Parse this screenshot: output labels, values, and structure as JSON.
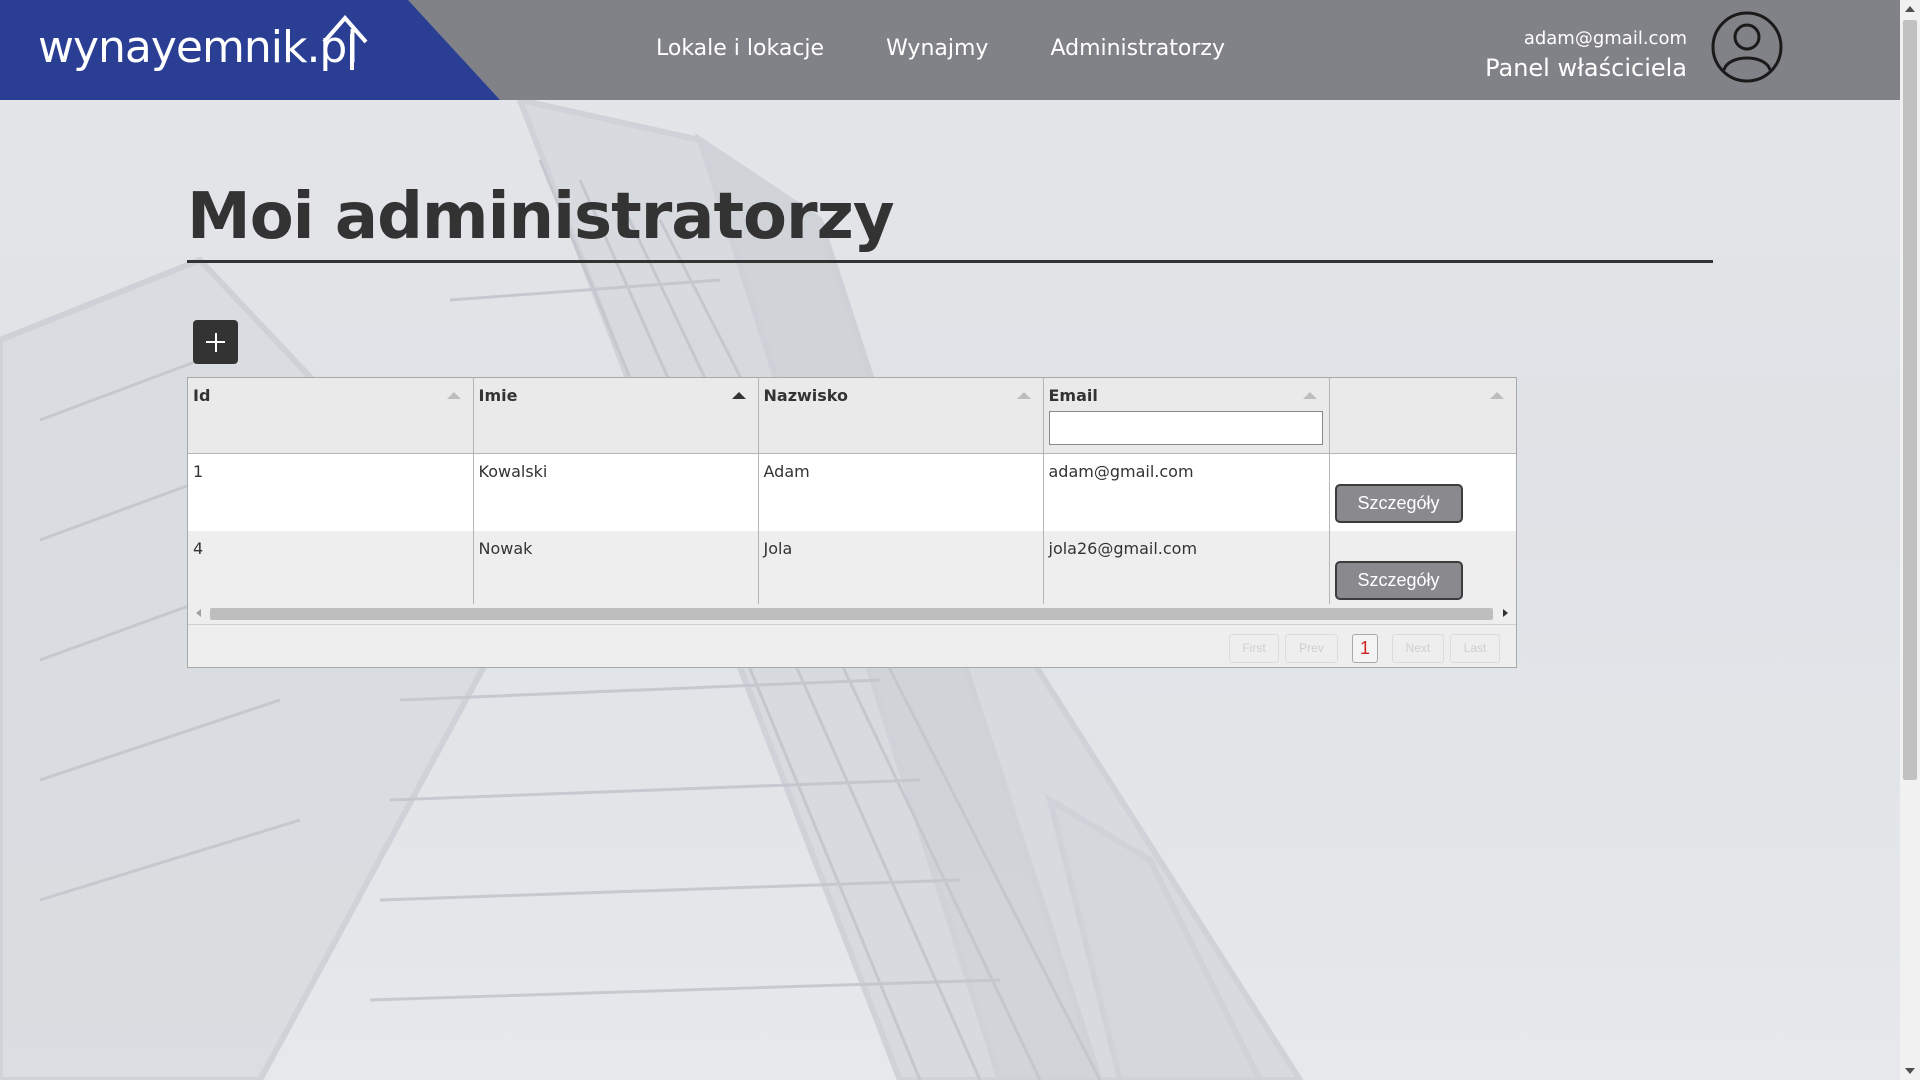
{
  "header": {
    "logo_text": "wynayemnik.pl",
    "nav": [
      "Lokale i lokacje",
      "Wynajmy",
      "Administratorzy"
    ],
    "user_email": "adam@gmail.com",
    "panel_label": "Panel właściciela"
  },
  "page": {
    "title": "Moi administratorzy"
  },
  "table": {
    "columns": [
      "Id",
      "Imie",
      "Nazwisko",
      "Email",
      ""
    ],
    "email_filter_value": "",
    "rows": [
      {
        "id": "1",
        "imie": "Kowalski",
        "nazwisko": "Adam",
        "email": "adam@gmail.com",
        "action": "Szczegóły"
      },
      {
        "id": "4",
        "imie": "Nowak",
        "nazwisko": "Jola",
        "email": "jola26@gmail.com",
        "action": "Szczegóły"
      }
    ],
    "pager": {
      "first": "First",
      "prev": "Prev",
      "current": "1",
      "next": "Next",
      "last": "Last"
    }
  },
  "colors": {
    "header_bg": "#818287",
    "logo_bg": "#2a3f94",
    "title": "#333333",
    "current_page": "#cc2222"
  },
  "icons": {
    "logo": "house-icon",
    "avatar": "user-circle-icon",
    "add": "plus-icon"
  }
}
